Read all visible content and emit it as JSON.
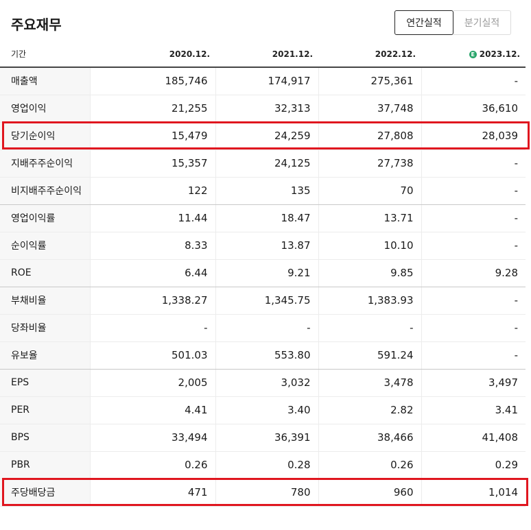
{
  "title": "주요재무",
  "buttons": {
    "annual": "연간실적",
    "quarterly": "분기실적"
  },
  "header": {
    "label": "기간",
    "estimate_badge": "E",
    "periods": [
      "2020.12.",
      "2021.12.",
      "2022.12.",
      "2023.12."
    ]
  },
  "rows": [
    {
      "label": "매출액",
      "values": [
        "185,746",
        "174,917",
        "275,361",
        "-"
      ]
    },
    {
      "label": "영업이익",
      "values": [
        "21,255",
        "32,313",
        "37,748",
        "36,610"
      ]
    },
    {
      "label": "당기순이익",
      "values": [
        "15,479",
        "24,259",
        "27,808",
        "28,039"
      ]
    },
    {
      "label": "지배주주순이익",
      "values": [
        "15,357",
        "24,125",
        "27,738",
        "-"
      ]
    },
    {
      "label": "비지배주주순이익",
      "values": [
        "122",
        "135",
        "70",
        "-"
      ]
    },
    {
      "label": "영업이익률",
      "values": [
        "11.44",
        "18.47",
        "13.71",
        "-"
      ]
    },
    {
      "label": "순이익률",
      "values": [
        "8.33",
        "13.87",
        "10.10",
        "-"
      ]
    },
    {
      "label": "ROE",
      "values": [
        "6.44",
        "9.21",
        "9.85",
        "9.28"
      ]
    },
    {
      "label": "부채비율",
      "values": [
        "1,338.27",
        "1,345.75",
        "1,383.93",
        "-"
      ]
    },
    {
      "label": "당좌비율",
      "values": [
        "-",
        "-",
        "-",
        "-"
      ]
    },
    {
      "label": "유보율",
      "values": [
        "501.03",
        "553.80",
        "591.24",
        "-"
      ]
    },
    {
      "label": "EPS",
      "values": [
        "2,005",
        "3,032",
        "3,478",
        "3,497"
      ]
    },
    {
      "label": "PER",
      "values": [
        "4.41",
        "3.40",
        "2.82",
        "3.41"
      ]
    },
    {
      "label": "BPS",
      "values": [
        "33,494",
        "36,391",
        "38,466",
        "41,408"
      ]
    },
    {
      "label": "PBR",
      "values": [
        "0.26",
        "0.28",
        "0.26",
        "0.29"
      ]
    },
    {
      "label": "주당배당금",
      "values": [
        "471",
        "780",
        "960",
        "1,014"
      ]
    }
  ],
  "colors": {
    "highlight": "#e0161f",
    "estimate": "#2aa56b"
  }
}
